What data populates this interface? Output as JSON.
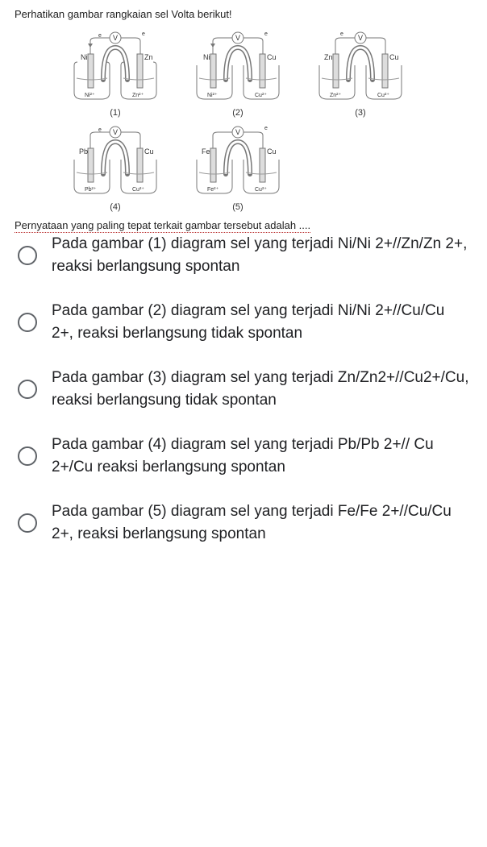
{
  "instruction": "Perhatikan gambar rangkaian sel Volta berikut!",
  "question": "Pernyataan yang paling tepat terkait gambar tersebut adalah ....",
  "cells": [
    {
      "id": "(1)",
      "leftElectrode": "Ni",
      "rightElectrode": "Zn",
      "leftIon": "Ni²⁺",
      "rightIon": "Zn²⁺"
    },
    {
      "id": "(2)",
      "leftElectrode": "Ni",
      "rightElectrode": "Cu",
      "leftIon": "Ni²⁺",
      "rightIon": "Cu²⁺"
    },
    {
      "id": "(3)",
      "leftElectrode": "Zn",
      "rightElectrode": "Cu",
      "leftIon": "Zn²⁺",
      "rightIon": "Cu²⁺"
    },
    {
      "id": "(4)",
      "leftElectrode": "Pb",
      "rightElectrode": "Cu",
      "leftIon": "Pb²⁺",
      "rightIon": "Cu²⁺"
    },
    {
      "id": "(5)",
      "leftElectrode": "Fe",
      "rightElectrode": "Cu",
      "leftIon": "Fe²⁺",
      "rightIon": "Cu²⁺"
    }
  ],
  "voltmeter": "V",
  "electronLabel": "e",
  "options": [
    "Pada gambar (1) diagram sel yang terjadi Ni/Ni 2+//Zn/Zn 2+, reaksi berlangsung spontan",
    "Pada gambar (2) diagram sel yang terjadi Ni/Ni 2+//Cu/Cu 2+, reaksi berlangsung tidak spontan",
    "Pada gambar (3) diagram sel yang terjadi Zn/Zn2+//Cu2+/Cu, reaksi berlangsung tidak spontan",
    "Pada gambar (4) diagram sel yang terjadi Pb/Pb 2+// Cu 2+/Cu reaksi berlangsung spontan",
    "Pada gambar (5) diagram sel yang terjadi Fe/Fe 2+//Cu/Cu 2+, reaksi berlangsung spontan"
  ]
}
